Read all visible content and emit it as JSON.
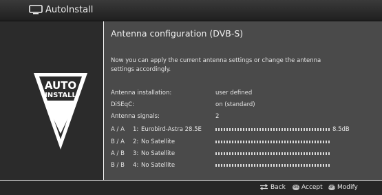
{
  "header": {
    "title": "AutoInstall",
    "icon": "tv-icon"
  },
  "logo": {
    "line1": "AUTO",
    "line2": "INSTALL",
    "icon": "autoinstall-logo-icon"
  },
  "main": {
    "heading": "Antenna configuration (DVB-S)",
    "description": "Now you can apply the current antenna settings or change the antenna settings accordingly."
  },
  "info": [
    {
      "label": "Antenna installation:",
      "value": "user defined"
    },
    {
      "label": "DiSEqC:",
      "value": "on (standard)"
    },
    {
      "label": "Antenna signals:",
      "value": "2"
    }
  ],
  "signals": [
    {
      "port": "A / A",
      "num": "1:",
      "name": "Eurobird-Astra 28.5E",
      "level": "8.5dB"
    },
    {
      "port": "B / A",
      "num": "2:",
      "name": "No Satellite",
      "level": ""
    },
    {
      "port": "A / B",
      "num": "3:",
      "name": "No Satellite",
      "level": ""
    },
    {
      "port": "B / B",
      "num": "4:",
      "name": "No Satellite",
      "level": ""
    }
  ],
  "footer": {
    "back": "Back",
    "accept": "Accept",
    "modify": "Modify",
    "ok_key": "OK",
    "opt_key": "OPT"
  },
  "colors": {
    "panel": "#4a4a4a",
    "sidebar": "#2b2b2b",
    "bar": "#262626"
  }
}
